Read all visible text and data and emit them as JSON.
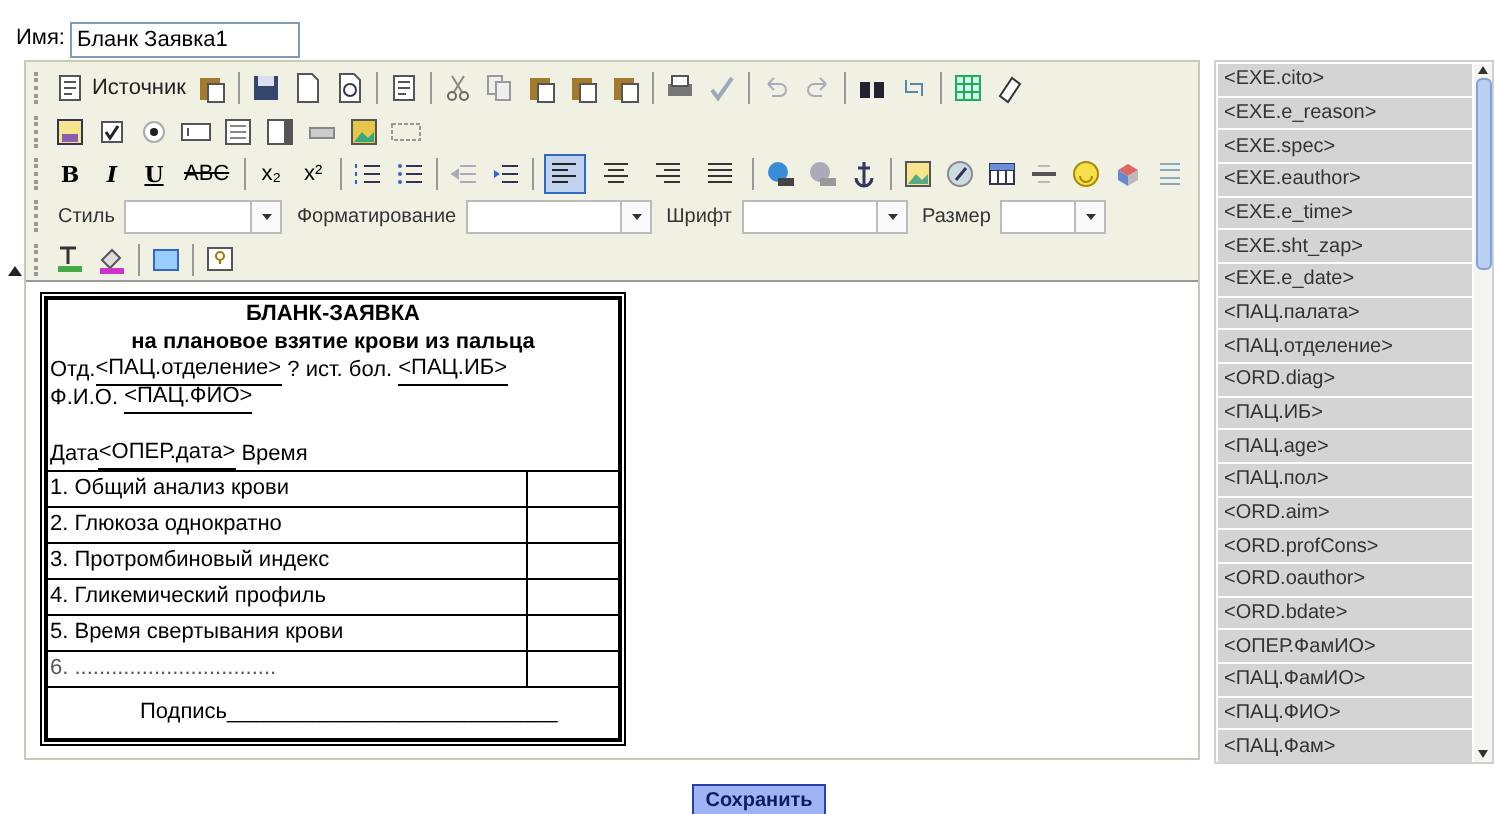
{
  "name_field": {
    "label": "Имя:",
    "value": "Бланк Заявка1"
  },
  "toolbar": {
    "source_label": "Источник",
    "format_buttons": [
      "B",
      "I",
      "U",
      "ABC",
      "x₂",
      "x²"
    ],
    "align_buttons": [
      {
        "selected": true
      },
      {
        "selected": false
      },
      {
        "selected": false
      },
      {
        "selected": false
      }
    ],
    "dropdowns": [
      {
        "label": "Стиль"
      },
      {
        "label": "Форматирование"
      },
      {
        "label": "Шрифт"
      },
      {
        "label": "Размер"
      }
    ]
  },
  "document": {
    "title": "БЛАНК-ЗАЯВКА",
    "subtitle": "на плановое взятие крови из пальца",
    "header_lines": [
      [
        {
          "text": "Отд.",
          "underlined": false
        },
        {
          "text": "<ПАЦ.отделение>",
          "underlined": true
        },
        {
          "text": " ? ист. бол. ",
          "underlined": false
        },
        {
          "text": "<ПАЦ.ИБ>",
          "underlined": true
        }
      ],
      [
        {
          "text": "Ф.И.О. ",
          "underlined": false
        },
        {
          "text": "<ПАЦ.ФИО>",
          "underlined": true
        }
      ],
      [
        {
          "text": "Дата",
          "underlined": false
        },
        {
          "text": "<ОПЕР.дата>",
          "underlined": true
        },
        {
          "text": " Время",
          "underlined": false
        }
      ]
    ],
    "rows": [
      "1. Общий анализ крови",
      "2. Глюкоза однократно",
      "3. Протромбиновый индекс",
      "4. Гликемический профиль",
      "5. Время свертывания крови",
      "6. ................................."
    ],
    "signature": "Подпись___________________________"
  },
  "fields_list": [
    "<EXE.cito>",
    "<EXE.e_reason>",
    "<EXE.spec>",
    "<EXE.eauthor>",
    "<EXE.e_time>",
    "<EXE.sht_zap>",
    "<EXE.e_date>",
    "<ПАЦ.палата>",
    "<ПАЦ.отделение>",
    "<ORD.diag>",
    "<ПАЦ.ИБ>",
    "<ПАЦ.age>",
    "<ПАЦ.пол>",
    "<ORD.aim>",
    "<ORD.profCons>",
    "<ORD.oauthor>",
    "<ORD.bdate>",
    "<ОПЕР.ФамИО>",
    "<ПАЦ.ФамИО>",
    "<ПАЦ.ФИО>",
    "<ПАЦ.Фам>"
  ],
  "save_button": "Сохранить"
}
